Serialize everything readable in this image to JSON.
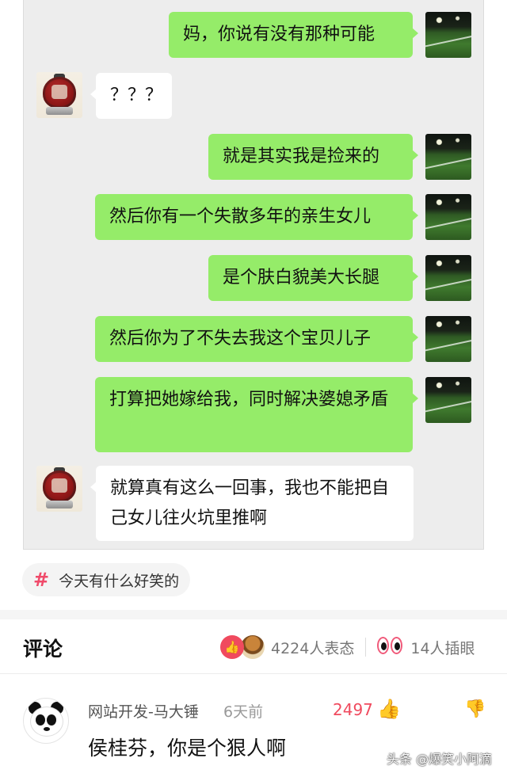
{
  "chat": {
    "messages": [
      {
        "side": "right",
        "text": "妈，你说有没有那种可能"
      },
      {
        "side": "left",
        "text": "？？？"
      },
      {
        "side": "right",
        "text": "就是其实我是捡来的"
      },
      {
        "side": "right",
        "text": "然后你有一个失散多年的亲生女儿"
      },
      {
        "side": "right",
        "text": "是个肤白貌美大长腿"
      },
      {
        "side": "right",
        "text": "然后你为了不失去我这个宝贝儿子"
      },
      {
        "side": "right",
        "text": "打算把她嫁给我，同时解决婆媳矛盾"
      },
      {
        "side": "left",
        "text": "就算真有这么一回事，我也不能把自己女儿往火坑里推啊"
      }
    ]
  },
  "topic": {
    "hash_symbol": "#",
    "label": "今天有什么好笑的"
  },
  "comments_header": {
    "title": "评论",
    "reaction_count": "4224人表态",
    "insert_eye_count": "14人插眼"
  },
  "comment": {
    "username": "网站开发-马大锤",
    "time": "6天前",
    "like_count": "2497",
    "text": "侯桂芬，你是个狠人啊"
  },
  "watermark": "头条 @爆笑小阿滴",
  "colors": {
    "bubble_right": "#95ec69",
    "bubble_left": "#ffffff",
    "accent": "#f04a5e"
  }
}
